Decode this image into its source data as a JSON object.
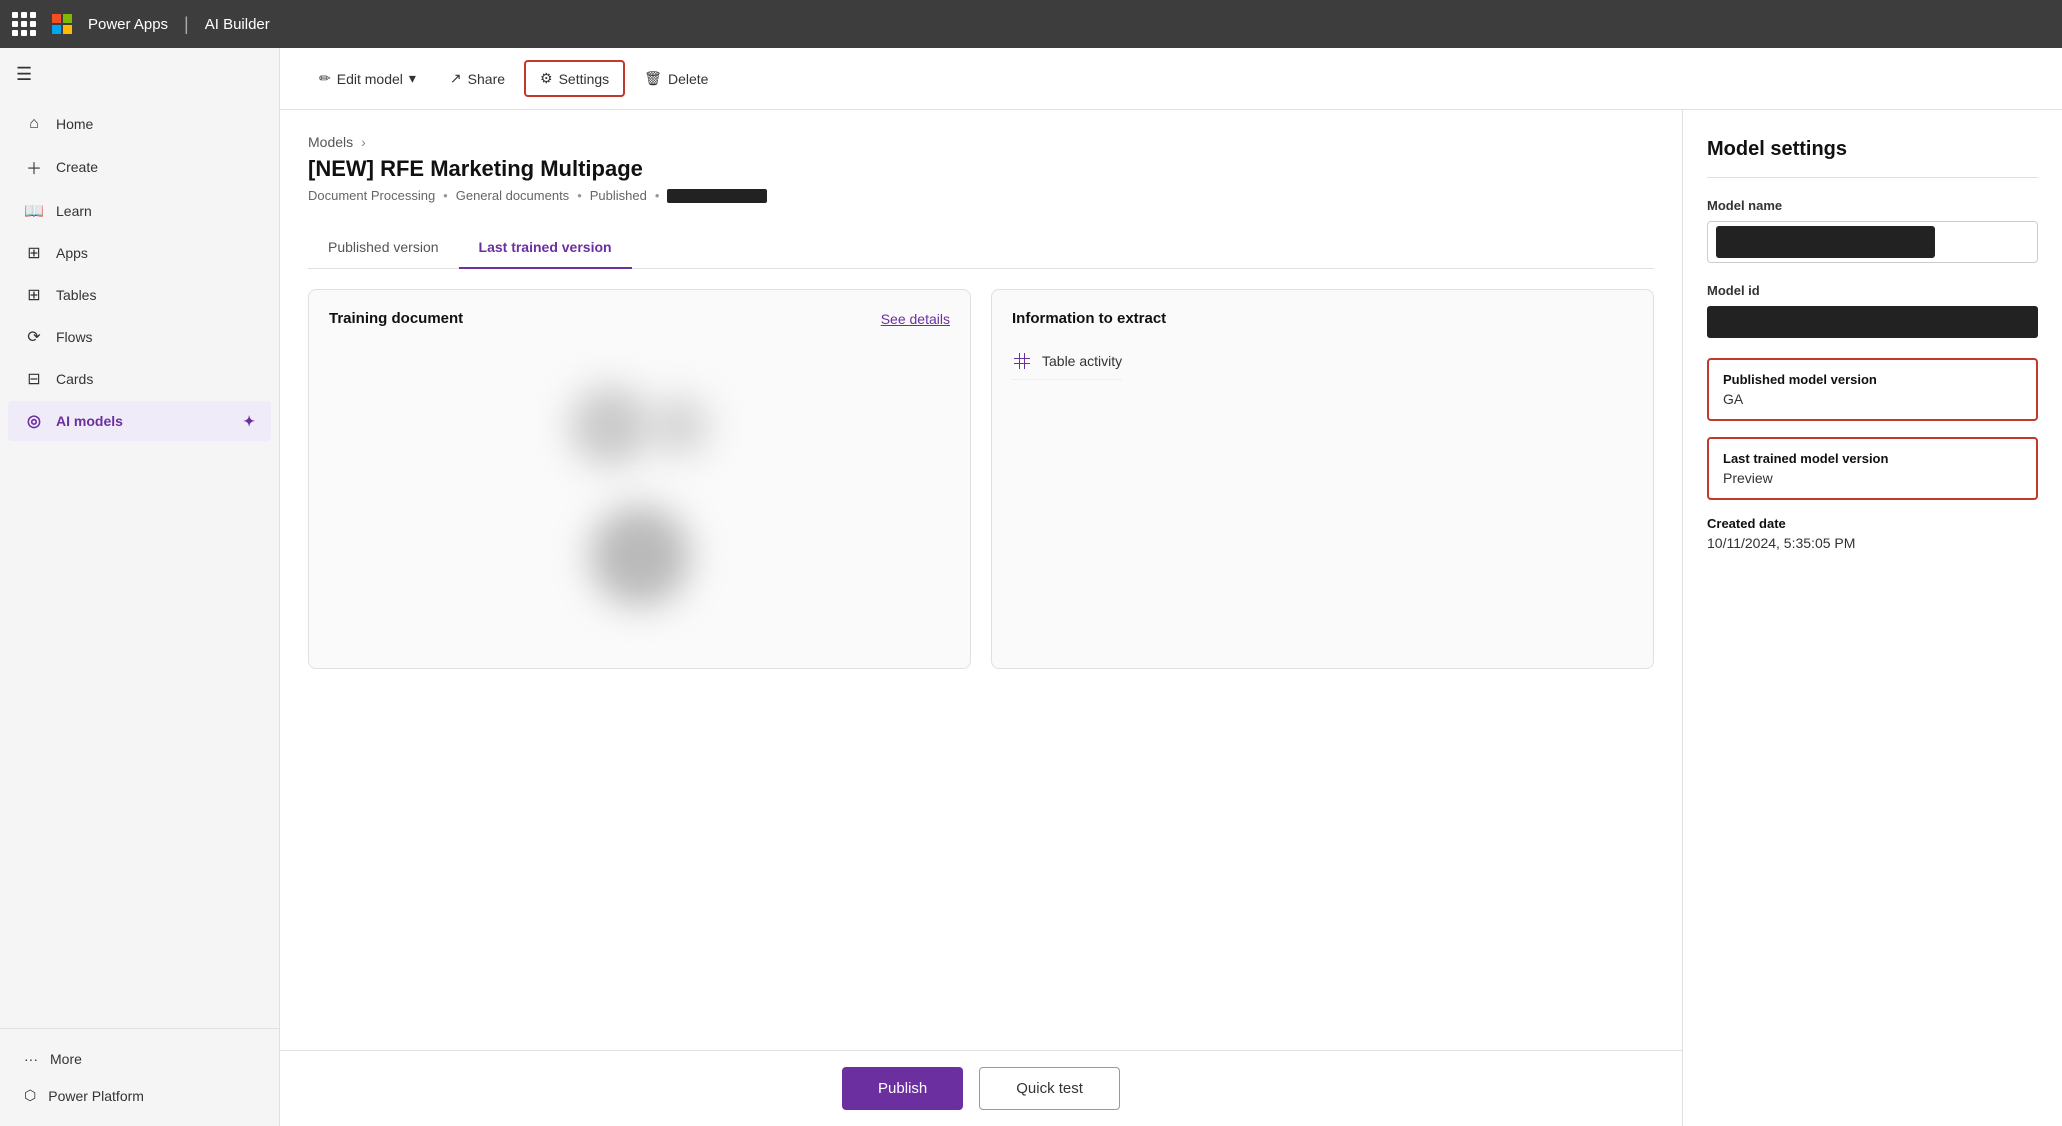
{
  "topbar": {
    "app_name": "Power Apps",
    "separator": "|",
    "product_name": "AI Builder"
  },
  "sidebar": {
    "items": [
      {
        "id": "home",
        "label": "Home",
        "icon": "⌂"
      },
      {
        "id": "create",
        "label": "Create",
        "icon": "+"
      },
      {
        "id": "learn",
        "label": "Learn",
        "icon": "📖"
      },
      {
        "id": "apps",
        "label": "Apps",
        "icon": "⊞"
      },
      {
        "id": "tables",
        "label": "Tables",
        "icon": "⊞"
      },
      {
        "id": "flows",
        "label": "Flows",
        "icon": "⟳"
      },
      {
        "id": "cards",
        "label": "Cards",
        "icon": "⊟"
      },
      {
        "id": "ai-models",
        "label": "AI models",
        "icon": "◎"
      }
    ],
    "bottom": [
      {
        "id": "more",
        "label": "More",
        "icon": "···"
      },
      {
        "id": "power-platform",
        "label": "Power Platform",
        "icon": "⬡"
      }
    ]
  },
  "toolbar": {
    "edit_model_label": "Edit model",
    "share_label": "Share",
    "settings_label": "Settings",
    "delete_label": "Delete"
  },
  "breadcrumb": {
    "parent": "Models",
    "current": "[NEW] RFE Marketing Multipage"
  },
  "page": {
    "title": "[NEW] RFE Marketing Multipage",
    "subtitle_type": "Document Processing",
    "subtitle_sep1": "•",
    "subtitle_general": "General documents",
    "subtitle_sep2": "•",
    "subtitle_status": "Published",
    "subtitle_sep3": "•"
  },
  "tabs": [
    {
      "id": "published",
      "label": "Published version"
    },
    {
      "id": "last-trained",
      "label": "Last trained version"
    }
  ],
  "active_tab": "last-trained",
  "training_card": {
    "title": "Training document",
    "link": "See details"
  },
  "info_card": {
    "title": "Information to extract",
    "items": [
      {
        "icon": "table",
        "label": "Table activity"
      }
    ]
  },
  "actions": {
    "publish_label": "Publish",
    "quick_test_label": "Quick test"
  },
  "right_panel": {
    "title": "Model settings",
    "model_name_label": "Model name",
    "model_id_label": "Model id",
    "published_version_label": "Published model version",
    "published_version_value": "GA",
    "last_trained_version_label": "Last trained model version",
    "last_trained_version_value": "Preview",
    "created_date_label": "Created date",
    "created_date_value": "10/11/2024, 5:35:05 PM"
  }
}
